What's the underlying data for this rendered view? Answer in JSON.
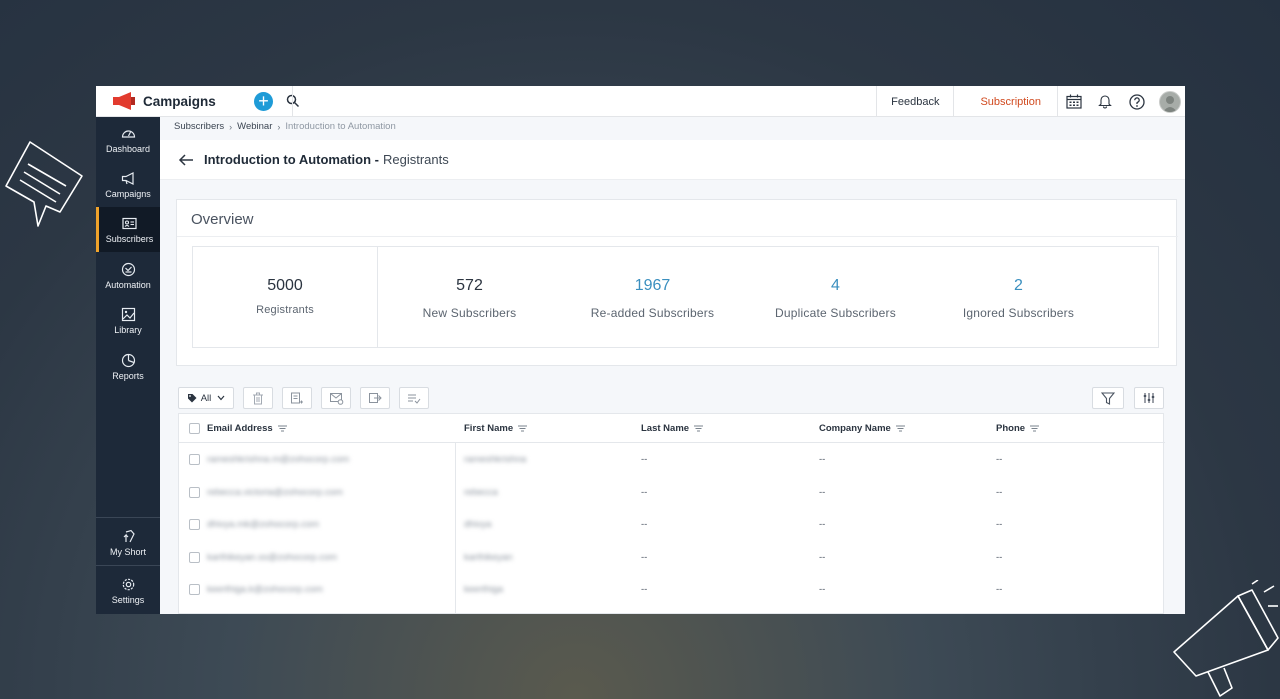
{
  "brand": {
    "name": "Campaigns"
  },
  "topbar": {
    "feedback": "Feedback",
    "subscription": "Subscription"
  },
  "sidebar": {
    "items": [
      {
        "label": "Dashboard",
        "icon": "dashboard-icon"
      },
      {
        "label": "Campaigns",
        "icon": "megaphone-icon"
      },
      {
        "label": "Subscribers",
        "icon": "subscribers-icon",
        "active": true
      },
      {
        "label": "Automation",
        "icon": "automation-icon"
      },
      {
        "label": "Library",
        "icon": "library-icon"
      },
      {
        "label": "Reports",
        "icon": "reports-icon"
      }
    ],
    "bottom": [
      {
        "label": "My Short",
        "icon": "shortcut-icon"
      },
      {
        "label": "Settings",
        "icon": "gear-icon"
      }
    ]
  },
  "breadcrumb": {
    "items": [
      "Subscribers",
      "Webinar"
    ],
    "current": "Introduction to Automation"
  },
  "page": {
    "title": "Introduction to Automation -",
    "subtitle": "Registrants"
  },
  "overview": {
    "title": "Overview",
    "main": {
      "value": "5000",
      "label": "Registrants"
    },
    "stats": [
      {
        "value": "572",
        "label": "New Subscribers",
        "highlight": false
      },
      {
        "value": "1967",
        "label": "Re-added Subscribers",
        "highlight": true
      },
      {
        "value": "4",
        "label": "Duplicate Subscribers",
        "highlight": true
      },
      {
        "value": "2",
        "label": "Ignored Subscribers",
        "highlight": true
      }
    ],
    "highlight_color": "#3a8fbf"
  },
  "toolbar": {
    "tag_filter": "All"
  },
  "table": {
    "columns": [
      "Email Address",
      "First Name",
      "Last Name",
      "Company Name",
      "Phone"
    ],
    "rows": [
      [
        "rameshkrishna.m@zohocorp.com",
        "rameshkrishna",
        "--",
        "--",
        "--"
      ],
      [
        "rebecca.victoria@zohocorp.com",
        "rebecca",
        "--",
        "--",
        "--"
      ],
      [
        "dhivya.mk@zohocorp.com",
        "dhivya",
        "--",
        "--",
        "--"
      ],
      [
        "karthikeyan.ss@zohocorp.com",
        "karthikeyan",
        "--",
        "--",
        "--"
      ],
      [
        "keerthiga.k@zohocorp.com",
        "keerthiga",
        "--",
        "--",
        "--"
      ]
    ]
  },
  "colors": {
    "sidebar": "#1d2939",
    "accent": "#1e9bd7",
    "subscription": "#d14a1f",
    "active_marker": "#f0a32b"
  }
}
